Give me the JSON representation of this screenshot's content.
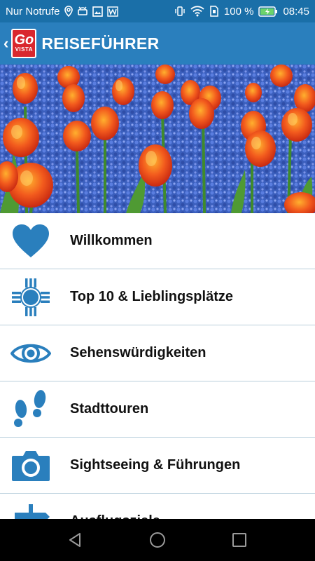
{
  "status_bar": {
    "carrier": "Nur Notrufe",
    "battery_percent": "100 %",
    "time": "08:45"
  },
  "app_bar": {
    "back_icon": "chevron-left-icon",
    "logo": {
      "line1": "Go",
      "line2": "VISTA"
    },
    "title": "REISEFÜHRER"
  },
  "hero": {
    "subject": "tulips-and-grape-hyacinths-photo"
  },
  "menu": {
    "items": [
      {
        "label": "Willkommen",
        "icon": "heart-icon"
      },
      {
        "label": "Top 10 & Lieblingsplätze",
        "icon": "sun-symbol-icon"
      },
      {
        "label": "Sehenswürdigkeiten",
        "icon": "eye-icon"
      },
      {
        "label": "Stadttouren",
        "icon": "footprints-icon"
      },
      {
        "label": "Sightseeing & Führungen",
        "icon": "camera-icon"
      },
      {
        "label": "Ausflugsziele",
        "icon": "signpost-icon"
      }
    ]
  },
  "nav_bar": {
    "back": "nav-back-icon",
    "home": "nav-home-icon",
    "recents": "nav-recents-icon"
  },
  "colors": {
    "status_bar": "#1a6fa8",
    "app_bar": "#2a7fbd",
    "icon_blue": "#2a7fbd",
    "logo_red": "#d9272e",
    "divider": "#b9cfdc"
  }
}
